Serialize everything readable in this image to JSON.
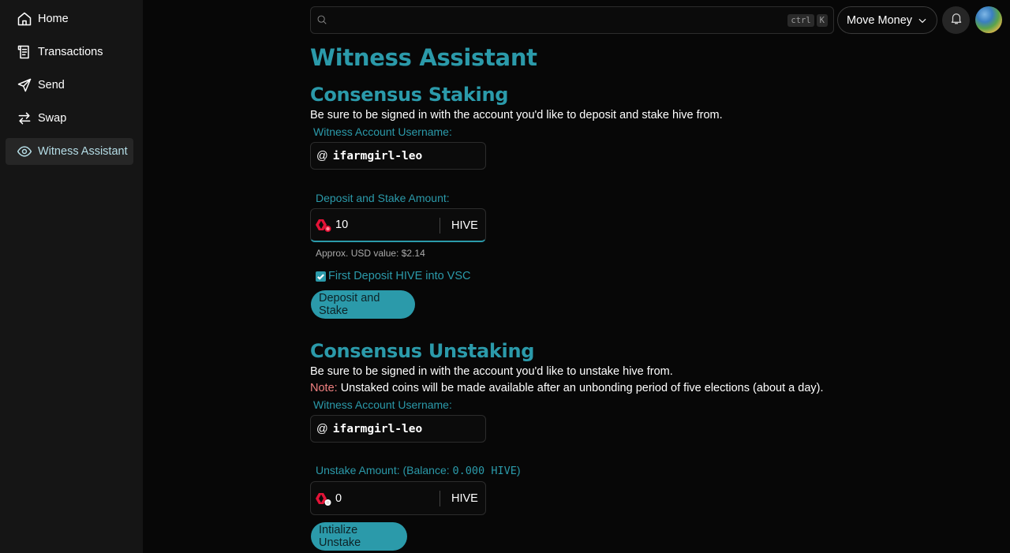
{
  "sidebar": {
    "items": [
      {
        "label": "Home",
        "icon": "home-icon"
      },
      {
        "label": "Transactions",
        "icon": "receipt-icon"
      },
      {
        "label": "Send",
        "icon": "send-icon"
      },
      {
        "label": "Swap",
        "icon": "swap-icon"
      },
      {
        "label": "Witness Assistant",
        "icon": "eye-icon",
        "active": true
      }
    ]
  },
  "header": {
    "search": {
      "placeholder": "",
      "shortcut_ctrl": "ctrl",
      "shortcut_key": "K"
    },
    "move_money_label": "Move Money"
  },
  "page": {
    "title": "Witness Assistant"
  },
  "staking": {
    "heading": "Consensus Staking",
    "description": "Be sure to be signed in with the account you'd like to deposit and stake hive from.",
    "username_label": "Witness Account Username:",
    "username_prefix": "@",
    "username_value": "ifarmgirl-leo",
    "amount_label": "Deposit and Stake Amount:",
    "amount_value": "10",
    "amount_unit": "HIVE",
    "approx_usd": "Approx. USD value: $2.14",
    "checkbox_label": "First Deposit HIVE into VSC",
    "checkbox_checked": true,
    "button_label": "Deposit and Stake"
  },
  "unstaking": {
    "heading": "Consensus Unstaking",
    "description": "Be sure to be signed in with the account you'd like to unstake hive from.",
    "note_label": "Note:",
    "note_text": " Unstaked coins will be made available after an unbonding period of five elections (about a day).",
    "username_label": "Witness Account Username:",
    "username_prefix": "@",
    "username_value": "ifarmgirl-leo",
    "amount_label_prefix": "Unstake Amount: (Balance: ",
    "amount_balance": "0.000 HIVE",
    "amount_label_suffix": ")",
    "amount_value": "0",
    "amount_unit": "HIVE",
    "button_label": "Intialize Unstake"
  },
  "colors": {
    "accent": "#2b9aaa",
    "note": "#f08080",
    "hive": "#e31337"
  }
}
